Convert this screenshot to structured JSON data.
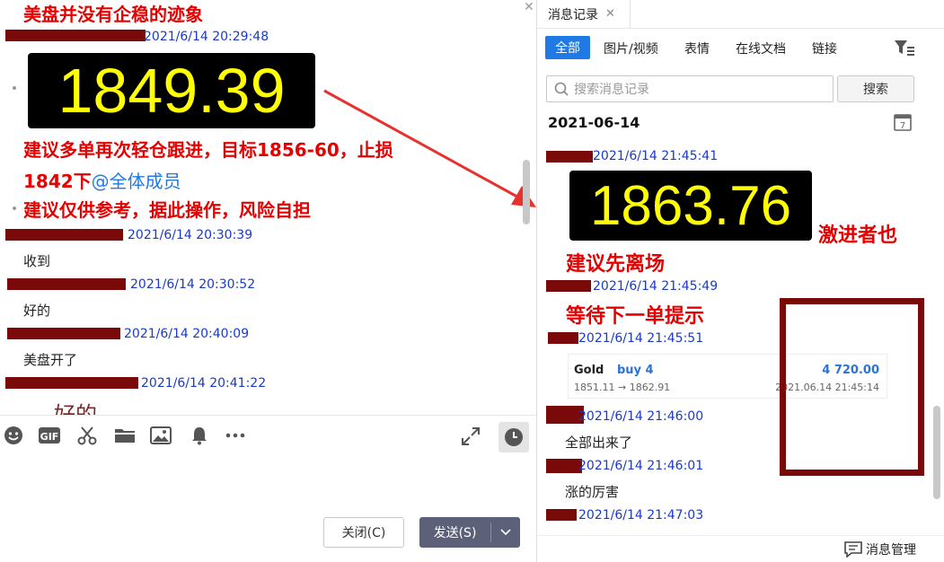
{
  "left": {
    "headline": "美盘并没有企稳的迹象",
    "messages": [
      {
        "time": "2021/6/14 20:29:48"
      },
      {
        "time": "2021/6/14 20:30:39",
        "text": "收到"
      },
      {
        "time": "2021/6/14 20:30:52",
        "text": "好的"
      },
      {
        "time": "2021/6/14 20:40:09",
        "text": "美盘开了"
      },
      {
        "time": "2021/6/14 20:41:22",
        "text": "好的"
      }
    ],
    "price_box": "1849.39",
    "advice_line1": "建议多单再次轻仓跟进，目标1856-60，止损",
    "advice_line2_prefix": "1842下",
    "mention": "@全体成员",
    "advice_line3": "建议仅供参考，据此操作，风险自担",
    "toolbar_icons": [
      "emoji-icon",
      "gif-icon",
      "scissors-icon",
      "folder-icon",
      "image-icon",
      "bell-icon",
      "more-icon"
    ],
    "close_label": "关闭(C)",
    "send_label": "发送(S)"
  },
  "right": {
    "window_tab": "消息记录",
    "filter_tabs": [
      "全部",
      "图片/视频",
      "表情",
      "在线文档",
      "链接"
    ],
    "search_placeholder": "搜索消息记录",
    "search_button": "搜索",
    "date": "2021-06-14",
    "messages": [
      {
        "time": "2021/6/14 21:45:41"
      },
      {
        "time": "2021/6/14 21:45:49"
      },
      {
        "time": "2021/6/14 21:45:51"
      },
      {
        "time": "2021/6/14 21:46:00",
        "text": "全部出来了"
      },
      {
        "time": "2021/6/14 21:46:01",
        "text": "涨的厉害"
      },
      {
        "time": "2021/6/14 21:47:03"
      }
    ],
    "price_box": "1863.76",
    "aggressive_note": "激进者也",
    "advice_exit": "建议先离场",
    "advice_wait": "等待下一单提示",
    "trade_card": {
      "symbol": "Gold",
      "action": "buy 4",
      "amount": "4 720.00",
      "prices": "1851.11 → 1862.91",
      "datetime": "2021.06.14 21:45:14"
    },
    "manage_label": "消息管理"
  },
  "colors": {
    "accent_blue": "#1f7ae6",
    "annotation_red": "#e60000",
    "redaction": "#7a0a0a",
    "price_yellow": "#ffff00"
  }
}
